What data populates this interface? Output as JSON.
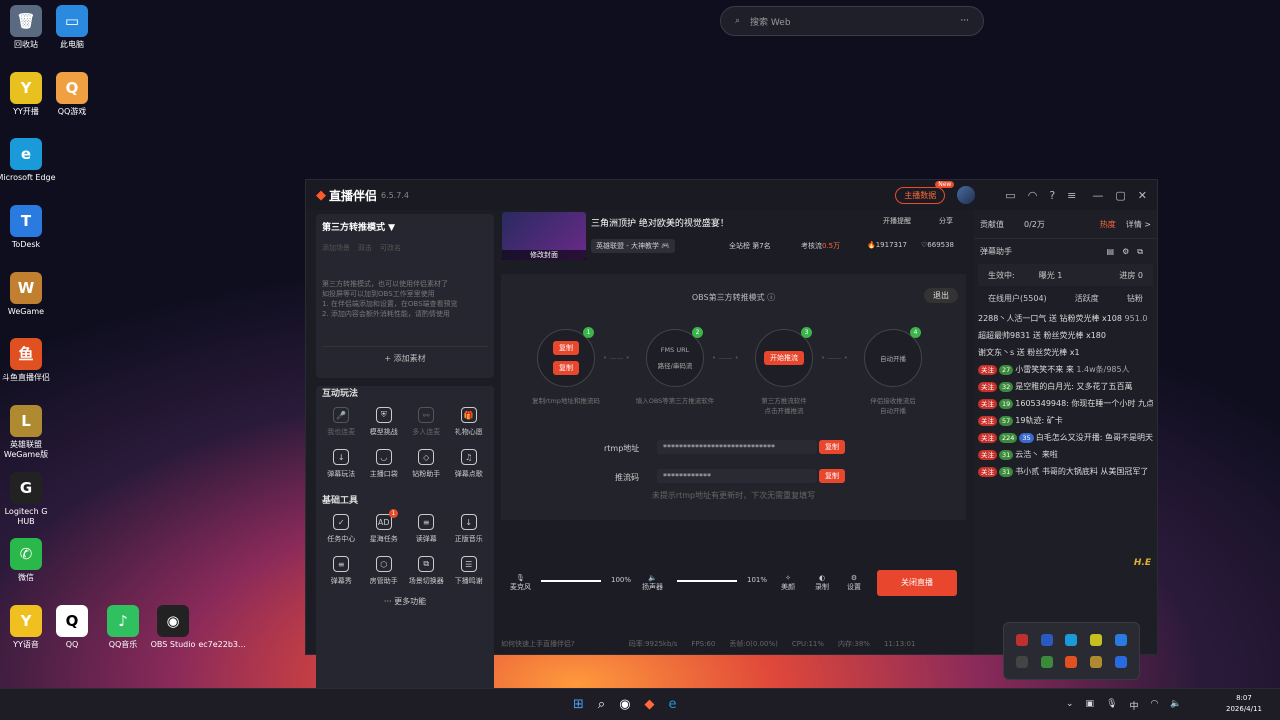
{
  "desktop": {
    "icons": [
      {
        "label": "回收站",
        "glyph": "🗑",
        "color": "#5a6a80"
      },
      {
        "label": "此电脑",
        "glyph": "▭",
        "color": "#2a8ae0"
      },
      {
        "label": "YY开播",
        "glyph": "Y",
        "color": "#e8c020"
      },
      {
        "label": "QQ游戏",
        "glyph": "Q",
        "color": "#f0a040"
      },
      {
        "label": "Microsoft Edge",
        "glyph": "e",
        "color": "#1a9ad8"
      },
      {
        "label": "ToDesk",
        "glyph": "T",
        "color": "#2a7ae0"
      },
      {
        "label": "WeGame",
        "glyph": "W",
        "color": "#c08030"
      },
      {
        "label": "斗鱼直播伴侣",
        "glyph": "鱼",
        "color": "#e05020"
      },
      {
        "label": "英雄联盟 WeGame版",
        "glyph": "L",
        "color": "#b08a30"
      },
      {
        "label": "Logitech G HUB",
        "glyph": "G",
        "color": "#222"
      },
      {
        "label": "微信",
        "glyph": "✆",
        "color": "#2ab84a"
      },
      {
        "label": "YY语音",
        "glyph": "Y",
        "color": "#f0c020"
      },
      {
        "label": "QQ",
        "glyph": "Q",
        "color": "#fff"
      },
      {
        "label": "QQ音乐",
        "glyph": "♪",
        "color": "#30c060"
      },
      {
        "label": "OBS Studio",
        "glyph": "◉",
        "color": "#222"
      },
      {
        "label": "ec7e22b3...",
        "glyph": "",
        "color": "transparent"
      }
    ]
  },
  "search": {
    "placeholder": "搜索 Web"
  },
  "app": {
    "name": "直播伴侣",
    "version": "6.5.7.4",
    "host_data": "主播数据",
    "new_badge": "New",
    "mode_title": "第三方转推模式 ▼",
    "placeholder_tabs": [
      "添加场景",
      "双击",
      "可改名"
    ],
    "mode_desc": [
      "第三方转推模式，也可以使用伴侣素材了",
      "如投屏等可以加到OBS工作室里使用",
      "1. 在伴侣端添加和设置，在OBS端查看预览",
      "2. 添加内容会额外消耗性能，请酌情使用"
    ],
    "add_material": "+ 添加素材",
    "interact_title": "互动玩法",
    "interact_tools": [
      {
        "label": "我也连麦",
        "icon": "🎤",
        "dim": true
      },
      {
        "label": "模型挑战",
        "icon": "⛨",
        "dim": false
      },
      {
        "label": "多人连麦",
        "icon": "⚯",
        "dim": true
      },
      {
        "label": "礼物心愿",
        "icon": "🎁",
        "dim": false
      },
      {
        "label": "弹幕玩法",
        "icon": "↓",
        "dim": false
      },
      {
        "label": "主播口袋",
        "icon": "◡",
        "dim": false
      },
      {
        "label": "钻粉助手",
        "icon": "◇",
        "dim": false
      },
      {
        "label": "弹幕点歌",
        "icon": "♫",
        "dim": false
      }
    ],
    "basic_title": "基础工具",
    "basic_tools": [
      {
        "label": "任务中心",
        "icon": "✓",
        "badge": ""
      },
      {
        "label": "星海任务",
        "icon": "AD",
        "badge": "1"
      },
      {
        "label": "读弹幕",
        "icon": "≡",
        "badge": ""
      },
      {
        "label": "正版音乐",
        "icon": "↓",
        "badge": ""
      },
      {
        "label": "弹幕秀",
        "icon": "≡",
        "badge": ""
      },
      {
        "label": "房管助手",
        "icon": "⬡",
        "badge": ""
      },
      {
        "label": "场景切换器",
        "icon": "⧉",
        "badge": ""
      },
      {
        "label": "下播鸣谢",
        "icon": "☰",
        "badge": ""
      }
    ],
    "more_tools": "··· 更多功能",
    "stream_title": "三角洲顶护 绝对欧美的视觉盛宴！",
    "cover_label": "修改封面",
    "category": "英雄联盟 - 大神教学 🎮",
    "rank": "全站榜 第7名",
    "assess": "考核流",
    "assess_val": "0.5万",
    "fire": "1917317",
    "likes": "669538",
    "remind": "开播提醒",
    "share": "分享",
    "obs_title": "OBS第三方转推模式 ⓘ",
    "exit": "退出",
    "steps": [
      {
        "num": "1",
        "buttons": [
          "复制",
          "复制"
        ],
        "caption": [
          "复制rtmp地址和推流码",
          ""
        ]
      },
      {
        "num": "2",
        "buttons": [
          "FMS URL",
          "路径/串码流"
        ],
        "caption": [
          "填入OBS等第三方推流软件",
          ""
        ]
      },
      {
        "num": "3",
        "buttons": [
          "开始推流"
        ],
        "caption": [
          "第三方推流软件",
          "点击开播推流"
        ]
      },
      {
        "num": "4",
        "buttons": [
          "自动开播"
        ],
        "caption": [
          "伴侣接收推流后",
          "自动开播"
        ]
      }
    ],
    "rtmp_label": "rtmp地址",
    "rtmp_value": "****************************",
    "key_label": "推流码",
    "key_value": "************",
    "copy": "复制",
    "rtmp_note": "未提示rtmp地址有更新时，下次无需重复填写",
    "mic_label": "麦克风",
    "mic_pct": "100%",
    "mic_level": 1.0,
    "spk_label": "扬声器",
    "spk_pct": "101%",
    "spk_level": 1.0,
    "beauty": "美颜",
    "record": "录制",
    "settings": "设置",
    "close_live": "关闭直播",
    "help": "如何快速上手直播伴侣?",
    "status": {
      "bitrate": "码率:9925kb/s",
      "fps": "FPS:60",
      "drop": "丢帧:0(0.00%)",
      "cpu": "CPU:11%",
      "mem": "内存:38%",
      "time": "11:13:01"
    },
    "contrib_label": "贡献值",
    "contrib_val": "0/2万",
    "heat": "热度",
    "detail": "详情 >",
    "danmu_title": "弹幕助手",
    "effect_label": "生效中:",
    "effect_exposure": "曝光 1",
    "effect_enter": "进房 0",
    "tabs": [
      "在线用户(5504)",
      "活跃度",
      "钻粉"
    ],
    "chat": [
      {
        "tags": [],
        "text": "2288丶人活一口气 送 钻粉荧光棒 x108",
        "extra": "951.0"
      },
      {
        "tags": [],
        "text": "超超最帅9831 送 粉丝荧光棒 x180",
        "extra": ""
      },
      {
        "tags": [],
        "text": "谢文东丶s 送 粉丝荧光棒 x1",
        "extra": ""
      },
      {
        "tags": [
          "关注",
          "27"
        ],
        "text": "小雷笑笑不来 来",
        "extra": "1.4w条/985人"
      },
      {
        "tags": [
          "关注",
          "32"
        ],
        "text": "是空稚的白月光: 又多花了五百萬",
        "extra": ""
      },
      {
        "tags": [
          "关注",
          "19"
        ],
        "text": "1605349948: 你现在睡一个小时 九点起来开播 知不知道",
        "extra": ""
      },
      {
        "tags": [
          "关注",
          "57"
        ],
        "text": "19轨迹: 矿卡",
        "extra": ""
      },
      {
        "tags": [
          "关注",
          "224",
          "35"
        ],
        "text": "白毛怎么又没开播: 鱼哥不是明天才回吗",
        "extra": ""
      },
      {
        "tags": [
          "关注",
          "31"
        ],
        "text": "云浩丶 来啦",
        "extra": ""
      },
      {
        "tags": [
          "关注",
          "31"
        ],
        "text": "书小贰 书哥的大锅底料 从美国冠军了",
        "extra": ""
      }
    ],
    "watermark": "H.E"
  },
  "taskbar": {
    "time": "8:07",
    "date": "2026/4/11",
    "ime": "中"
  }
}
